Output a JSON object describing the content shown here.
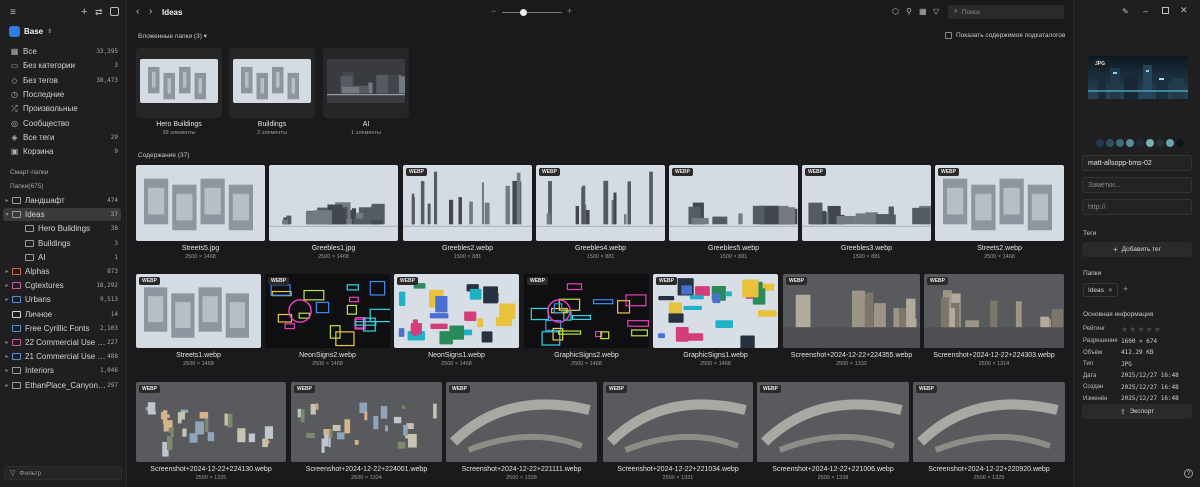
{
  "sidebar": {
    "library": "Base",
    "items": [
      {
        "label": "Все",
        "count": "33,395",
        "icon": "grid-icon"
      },
      {
        "label": "Без категории",
        "count": "3",
        "icon": "folder-icon"
      },
      {
        "label": "Без тегов",
        "count": "38,473",
        "icon": "tag-icon"
      },
      {
        "label": "Последние",
        "count": "",
        "icon": "clock-icon"
      },
      {
        "label": "Произвольные",
        "count": "",
        "icon": "shuffle-icon"
      },
      {
        "label": "Сообщество",
        "count": "",
        "icon": "globe-icon"
      },
      {
        "label": "Все теги",
        "count": "29",
        "icon": "tags-icon"
      },
      {
        "label": "Корзина",
        "count": "9",
        "icon": "trash-icon"
      }
    ],
    "smart_folders_label": "Смарт-папки",
    "folders_label": "Папки(675)",
    "folders": [
      {
        "label": "Ландшафт",
        "count": "474",
        "level": 0,
        "chev": "▸",
        "color": "#9a9a9a"
      },
      {
        "label": "Ideas",
        "count": "37",
        "level": 0,
        "chev": "▾",
        "color": "#9a9a9a",
        "selected": true
      },
      {
        "label": "Hero Buildings",
        "count": "38",
        "level": 1,
        "chev": "",
        "color": "#9a9a9a"
      },
      {
        "label": "Buildings",
        "count": "3",
        "level": 1,
        "chev": "",
        "color": "#9a9a9a"
      },
      {
        "label": "AI",
        "count": "1",
        "level": 1,
        "chev": "",
        "color": "#9a9a9a"
      },
      {
        "label": "Alphas",
        "count": "873",
        "level": 0,
        "chev": "▸",
        "color": "#d06a4a"
      },
      {
        "label": "Cgtextures",
        "count": "18,292",
        "level": 0,
        "chev": "▸",
        "color": "#c65d9a"
      },
      {
        "label": "Urbans",
        "count": "9,513",
        "level": 0,
        "chev": "▸",
        "color": "#5a8fd0"
      },
      {
        "label": "Личное",
        "count": "14",
        "level": 0,
        "chev": "",
        "color": "#d6d6d6"
      },
      {
        "label": "Free Cyrillic Fonts",
        "count": "2,103",
        "level": 0,
        "chev": "",
        "color": "#5a8fd0"
      },
      {
        "label": "22 Commercial Use Ha...",
        "count": "227",
        "level": 0,
        "chev": "▸",
        "color": "#c65d9a"
      },
      {
        "label": "21 Commercial Use Sa...",
        "count": "488",
        "level": 0,
        "chev": "▸",
        "color": "#5a8fd0"
      },
      {
        "label": "Interiors",
        "count": "1,046",
        "level": 0,
        "chev": "▸",
        "color": "#9a9a9a"
      },
      {
        "label": "EthanPlace_CanyonRe...",
        "count": "297",
        "level": 0,
        "chev": "▸",
        "color": "#9a9a9a"
      }
    ],
    "filter_label": "Фильтр"
  },
  "toolbar": {
    "title": "Ideas",
    "search_placeholder": "Поиск",
    "zoom": 0.35
  },
  "subfolders": {
    "header": "Вложенные папки (3)",
    "show_sub_label": "Показать содержимое подкаталогов",
    "items": [
      {
        "name": "Hero Buildings",
        "count": "38 элементы"
      },
      {
        "name": "Buildings",
        "count": "3 элементы"
      },
      {
        "name": "AI",
        "count": "1 элементы"
      }
    ]
  },
  "content": {
    "header": "Содержание (37)",
    "rows": [
      [
        {
          "name": "Streets5.jpg",
          "dims": "2500 × 1468",
          "badge": "",
          "style": "street"
        },
        {
          "name": "Greebles1.jpg",
          "dims": "2500 × 1468",
          "badge": "",
          "style": "parts"
        },
        {
          "name": "Greebles2.webp",
          "dims": "1500 × 881",
          "badge": "WEBP",
          "style": "antenna"
        },
        {
          "name": "Greebles4.webp",
          "dims": "1500 × 881",
          "badge": "WEBP",
          "style": "antenna"
        },
        {
          "name": "Greebles5.webp",
          "dims": "1500 × 881",
          "badge": "WEBP",
          "style": "machines"
        },
        {
          "name": "Greebles3.webp",
          "dims": "1500 × 881",
          "badge": "WEBP",
          "style": "machines"
        },
        {
          "name": "Streets2.webp",
          "dims": "2500 × 1468",
          "badge": "WEBP",
          "style": "street"
        }
      ],
      [
        {
          "name": "Streets1.webp",
          "dims": "2500 × 1468",
          "badge": "WEBP",
          "style": "street"
        },
        {
          "name": "NeonSigns2.webp",
          "dims": "2500 × 1468",
          "badge": "WEBP",
          "style": "neon"
        },
        {
          "name": "NeonSigns1.webp",
          "dims": "2500 × 1468",
          "badge": "WEBP",
          "style": "signs"
        },
        {
          "name": "GraphicSigns2.webp",
          "dims": "2500 × 1468",
          "badge": "WEBP",
          "style": "neon"
        },
        {
          "name": "GraphicSigns1.webp",
          "dims": "2500 × 1468",
          "badge": "WEBP",
          "style": "signs"
        },
        {
          "name": "Screenshot+2024-12-22+224355.webp",
          "dims": "2500 × 1332",
          "badge": "WEBP",
          "style": "ruins"
        },
        {
          "name": "Screenshot+2024-12-22+224303.webp",
          "dims": "2500 × 1314",
          "badge": "WEBP",
          "style": "ruins"
        }
      ],
      [
        {
          "name": "Screenshot+2024-12-22+224130.webp",
          "dims": "2500 × 1325",
          "badge": "WEBP",
          "style": "props"
        },
        {
          "name": "Screenshot+2024-12-22+224001.webp",
          "dims": "2500 × 1324",
          "badge": "WEBP",
          "style": "props"
        },
        {
          "name": "Screenshot+2024-12-22+221111.webp",
          "dims": "2500 × 1328",
          "badge": "WEBP",
          "style": "road"
        },
        {
          "name": "Screenshot+2024-12-22+221034.webp",
          "dims": "2500 × 1331",
          "badge": "WEBP",
          "style": "road"
        },
        {
          "name": "Screenshot+2024-12-22+221006.webp",
          "dims": "2500 × 1328",
          "badge": "WEBP",
          "style": "road"
        },
        {
          "name": "Screenshot+2024-12-22+220920.webp",
          "dims": "2500 × 1329",
          "badge": "WEBP",
          "style": "road"
        }
      ]
    ]
  },
  "inspector": {
    "preview_badge": "JPG",
    "swatches": [
      "#253848",
      "#2f4f60",
      "#3a6c7a",
      "#5a8d96",
      "#1b2a35",
      "#7ab0b8",
      "#2a2f36",
      "#6ca2aa",
      "#111418"
    ],
    "name": "matt-allsopp-bms-02",
    "notes_placeholder": "Заметки...",
    "url_placeholder": "http://",
    "tags_label": "Теги",
    "add_tag": "Добавить тег",
    "folders_label": "Папки",
    "folder_chip": "Ideas",
    "info_label": "Основная информация",
    "rating_label": "Рейтинг",
    "rating": 0,
    "props": [
      {
        "k": "Разрешение",
        "v": "1600 × 674"
      },
      {
        "k": "Объём",
        "v": "412.29 KB"
      },
      {
        "k": "Тип",
        "v": "JPG"
      },
      {
        "k": "Дата",
        "v": "2025/12/27 16:48"
      },
      {
        "k": "Создан",
        "v": "2025/12/27 16:48"
      },
      {
        "k": "Изменён",
        "v": "2025/12/27 16:48"
      }
    ],
    "export": "Экспорт"
  }
}
